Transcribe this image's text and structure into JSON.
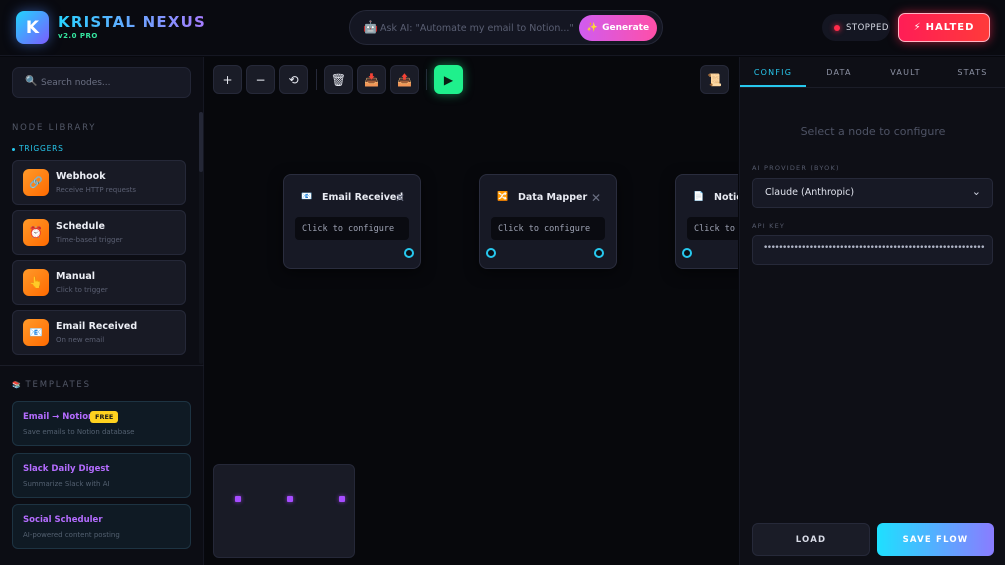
{
  "header": {
    "logo_letter": "K",
    "brand": "KRISTAL NEXUS",
    "version": "v2.0 PRO",
    "ai_placeholder": "Ask AI: \"Automate my email to Notion...\"",
    "generate_label": "Generate",
    "status_label": "STOPPED",
    "halted_label": "HALTED"
  },
  "sidebar": {
    "search_placeholder": "Search nodes...",
    "library_title": "NODE LIBRARY",
    "triggers_title": "TRIGGERS",
    "nodes": [
      {
        "name": "Webhook",
        "desc": "Receive HTTP requests",
        "icon": "link-icon"
      },
      {
        "name": "Schedule",
        "desc": "Time-based trigger",
        "icon": "alarm-clock-icon"
      },
      {
        "name": "Manual",
        "desc": "Click to trigger",
        "icon": "pointing-hand-icon"
      },
      {
        "name": "Email Received",
        "desc": "On new email",
        "icon": "email-icon"
      }
    ],
    "templates_title": "TEMPLATES",
    "templates": [
      {
        "name": "Email → Notion",
        "desc": "Save emails to Notion database",
        "badge": "FREE"
      },
      {
        "name": "Slack Daily Digest",
        "desc": "Summarize Slack with AI"
      },
      {
        "name": "Social Scheduler",
        "desc": "AI-powered content posting"
      }
    ]
  },
  "toolbar": {
    "zoom_in": "+",
    "zoom_out": "−",
    "reset": "⟲",
    "run": "▶"
  },
  "canvas": {
    "nodes": [
      {
        "title": "Email Received",
        "config": "Click to configure"
      },
      {
        "title": "Data Mapper",
        "config": "Click to configure"
      },
      {
        "title": "Notion",
        "config": "Click to configure"
      }
    ]
  },
  "panel": {
    "tabs": [
      "CONFIG",
      "DATA",
      "VAULT",
      "STATS"
    ],
    "active_tab": "CONFIG",
    "select_hint": "Select a node to configure",
    "provider_label": "AI PROVIDER (BYOK)",
    "provider_value": "Claude (Anthropic)",
    "api_key_label": "API KEY",
    "api_key_value": "••••••••••••••••••••••••••••••••••••••••••••••••••••••••••••••••••",
    "load_label": "LOAD",
    "save_label": "SAVE FLOW"
  },
  "colors": {
    "accent_cyan": "#27c8ee",
    "accent_purple": "#b46cff",
    "run_green": "#1ff08c",
    "halt_red": "#ff1d56",
    "trigger_orange": "#ff7a10"
  }
}
